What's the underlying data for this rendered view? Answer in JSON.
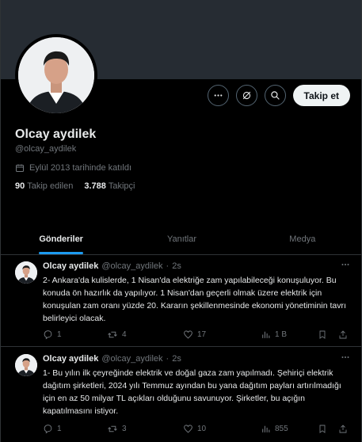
{
  "profile": {
    "name": "Olcay aydilek",
    "handle": "@olcay_aydilek",
    "joined": "Eylül 2013 tarihinde katıldı",
    "following_count": "90",
    "following_label": "Takip edilen",
    "followers_count": "3.788",
    "followers_label": "Takipçi",
    "follow_button": "Takip et"
  },
  "tabs": [
    {
      "label": "Gönderiler",
      "active": true
    },
    {
      "label": "Yanıtlar",
      "active": false
    },
    {
      "label": "Medya",
      "active": false
    }
  ],
  "tweets": [
    {
      "name": "Olcay aydilek",
      "handle": "@olcay_aydilek",
      "sep": "·",
      "time": "2s",
      "text": "2- Ankara'da kulislerde, 1 Nisan'da elektriğe zam yapılabileceği konuşuluyor. Bu konuda ön hazırlık da yapılıyor. 1 Nisan'dan geçerli olmak üzere elektrik için konuşulan zam oranı yüzde 20. Kararın şekillenmesinde ekonomi yönetiminin tavrı belirleyici olacak.",
      "replies": "1",
      "retweets": "4",
      "likes": "17",
      "views": "1 B"
    },
    {
      "name": "Olcay aydilek",
      "handle": "@olcay_aydilek",
      "sep": "·",
      "time": "2s",
      "text": "1- Bu yılın ilk çeyreğinde elektrik ve doğal gaza zam yapılmadı. Şehiriçi elektrik dağıtım şirketleri, 2024 yılı Temmuz ayından bu yana dağıtım payları artırılmadığı için en az 50 milyar TL açıkları olduğunu savunuyor. Şirketler, bu açığın kapatılmasını istiyor.",
      "replies": "1",
      "retweets": "3",
      "likes": "10",
      "views": "855"
    }
  ],
  "colors": {
    "accent": "#1d9bf0",
    "muted": "#71767b",
    "border": "#2f3336",
    "banner": "#262c33"
  }
}
